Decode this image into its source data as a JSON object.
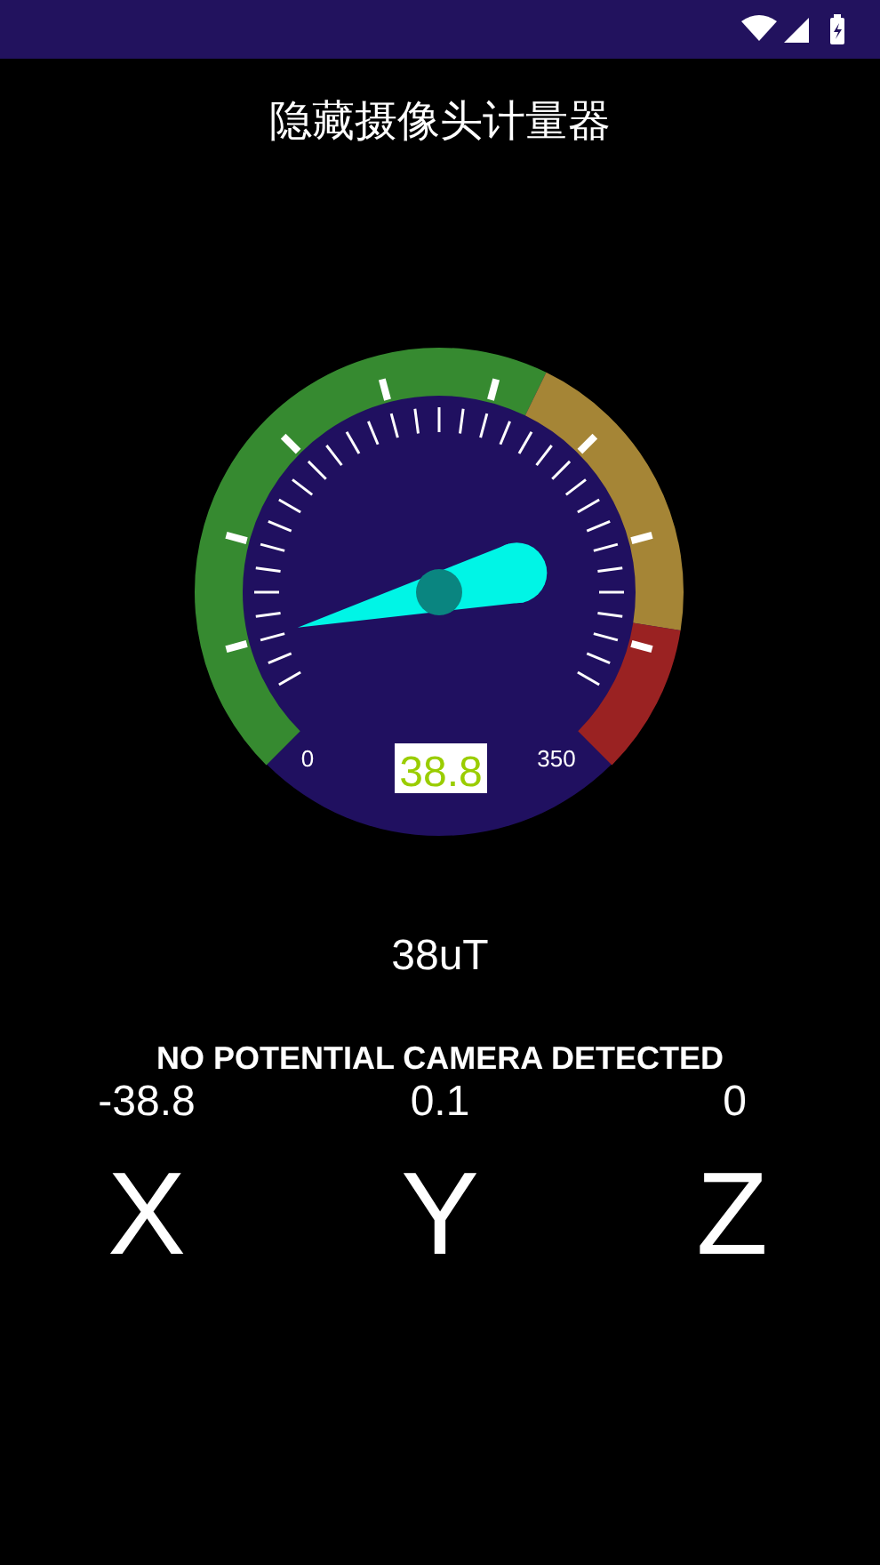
{
  "title": "隐藏摄像头计量器",
  "gauge": {
    "min_label": "0",
    "max_label": "350",
    "readout": "38.8"
  },
  "reading": "38uT",
  "status": "NO POTENTIAL CAMERA DETECTED",
  "axes": [
    {
      "value": "-38.8",
      "label": "X"
    },
    {
      "value": "0.1",
      "label": "Y"
    },
    {
      "value": "0",
      "label": "Z"
    }
  ]
}
